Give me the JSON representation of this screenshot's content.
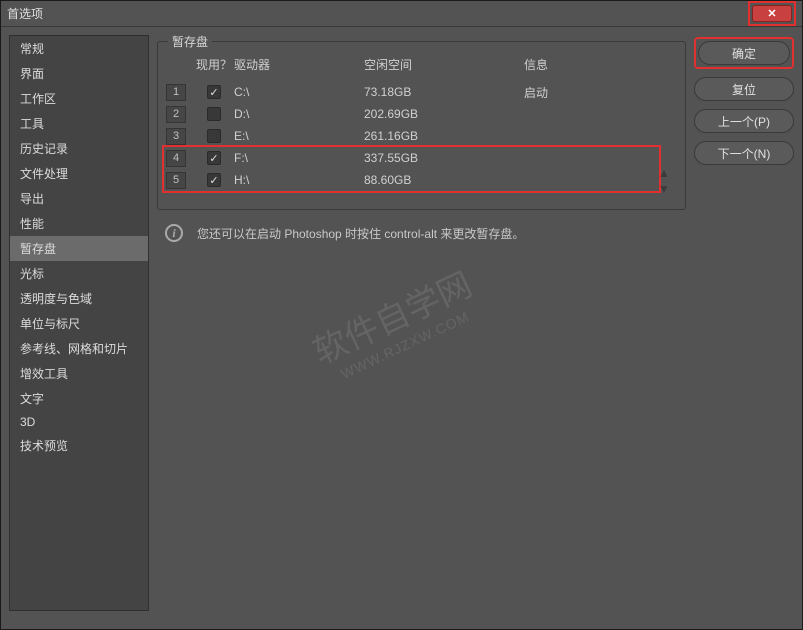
{
  "window": {
    "title": "首选项"
  },
  "sidebar": {
    "items": [
      {
        "label": "常规"
      },
      {
        "label": "界面"
      },
      {
        "label": "工作区"
      },
      {
        "label": "工具"
      },
      {
        "label": "历史记录"
      },
      {
        "label": "文件处理"
      },
      {
        "label": "导出"
      },
      {
        "label": "性能"
      },
      {
        "label": "暂存盘",
        "selected": true
      },
      {
        "label": "光标"
      },
      {
        "label": "透明度与色域"
      },
      {
        "label": "单位与标尺"
      },
      {
        "label": "参考线、网格和切片"
      },
      {
        "label": "增效工具"
      },
      {
        "label": "文字"
      },
      {
        "label": "3D"
      },
      {
        "label": "技术预览"
      }
    ]
  },
  "panel": {
    "legend": "暂存盘",
    "columns": {
      "active": "现用？",
      "drive": "驱动器",
      "free": "空闲空间",
      "info": "信息"
    },
    "rows": [
      {
        "idx": "1",
        "checked": true,
        "drive": "C:\\",
        "free": "73.18GB",
        "info": "启动"
      },
      {
        "idx": "2",
        "checked": false,
        "drive": "D:\\",
        "free": "202.69GB",
        "info": ""
      },
      {
        "idx": "3",
        "checked": false,
        "drive": "E:\\",
        "free": "261.16GB",
        "info": ""
      },
      {
        "idx": "4",
        "checked": true,
        "drive": "F:\\",
        "free": "337.55GB",
        "info": ""
      },
      {
        "idx": "5",
        "checked": true,
        "drive": "H:\\",
        "free": "88.60GB",
        "info": ""
      }
    ],
    "hint": "您还可以在启动 Photoshop 时按住 control-alt 来更改暂存盘。"
  },
  "buttons": {
    "ok": "确定",
    "reset": "复位",
    "prev": "上一个(P)",
    "next": "下一个(N)"
  },
  "watermark": {
    "line1": "软件自学网",
    "line2": "WWW.RJZXW.COM"
  },
  "colors": {
    "highlight": "#e03030"
  }
}
